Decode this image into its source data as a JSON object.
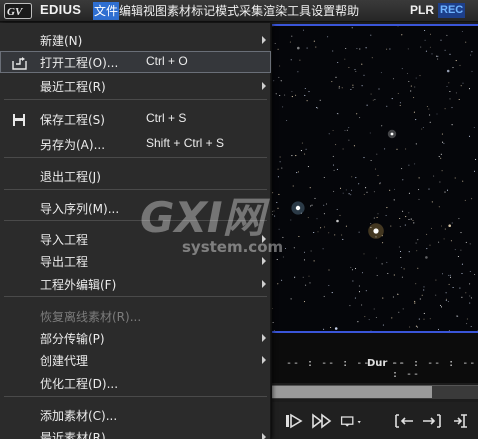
{
  "app": {
    "name": "EDIUS"
  },
  "menubar": {
    "items": [
      "文件",
      "编辑",
      "视图",
      "素材",
      "标记",
      "模式",
      "采集",
      "渲染",
      "工具",
      "设置",
      "帮助"
    ],
    "active_index": 0
  },
  "status": {
    "plr": "PLR",
    "rec": "REC"
  },
  "file_menu": {
    "items": [
      {
        "label": "新建(N)",
        "shortcut": "",
        "submenu": true,
        "icon": ""
      },
      {
        "label": "打开工程(O)...",
        "shortcut": "Ctrl + O",
        "submenu": false,
        "icon": "open-folder-icon",
        "highlighted": true
      },
      {
        "label": "最近工程(R)",
        "shortcut": "",
        "submenu": true,
        "icon": ""
      },
      {
        "label": "保存工程(S)",
        "shortcut": "Ctrl + S",
        "submenu": false,
        "icon": "floppy-disk-icon"
      },
      {
        "label": "另存为(A)...",
        "shortcut": "Shift + Ctrl + S",
        "submenu": false,
        "icon": ""
      },
      {
        "label": "退出工程(J)",
        "shortcut": "",
        "submenu": false,
        "icon": ""
      },
      {
        "label": "导入序列(M)...",
        "shortcut": "",
        "submenu": false,
        "icon": ""
      },
      {
        "label": "导入工程",
        "shortcut": "",
        "submenu": true,
        "icon": ""
      },
      {
        "label": "导出工程",
        "shortcut": "",
        "submenu": true,
        "icon": ""
      },
      {
        "label": "工程外编辑(F)",
        "shortcut": "",
        "submenu": true,
        "icon": ""
      },
      {
        "label": "恢复离线素材(R)...",
        "shortcut": "",
        "submenu": false,
        "icon": "",
        "disabled": true
      },
      {
        "label": "部分传输(P)",
        "shortcut": "",
        "submenu": true,
        "icon": ""
      },
      {
        "label": "创建代理",
        "shortcut": "",
        "submenu": true,
        "icon": ""
      },
      {
        "label": "优化工程(D)...",
        "shortcut": "",
        "submenu": false,
        "icon": ""
      },
      {
        "label": "添加素材(C)...",
        "shortcut": "",
        "submenu": false,
        "icon": ""
      },
      {
        "label": "最近素材(R)",
        "shortcut": "",
        "submenu": true,
        "icon": ""
      }
    ]
  },
  "monitor": {
    "timecode_left": "-- : -- : -- : --",
    "dur_label": "Dur",
    "timecode_right": "-- : -- : -- : --"
  },
  "transport": {
    "buttons": [
      "play-icon",
      "fast-forward-icon",
      "loop-icon",
      "mark-in-icon",
      "mark-out-icon",
      "mark-split-icon"
    ]
  },
  "watermark": {
    "brand": "GXI网",
    "domain": "system.com"
  },
  "colors": {
    "accent": "#2f6fd1",
    "monitor_border": "#3a55d8",
    "rec": "#6fb4ff"
  }
}
